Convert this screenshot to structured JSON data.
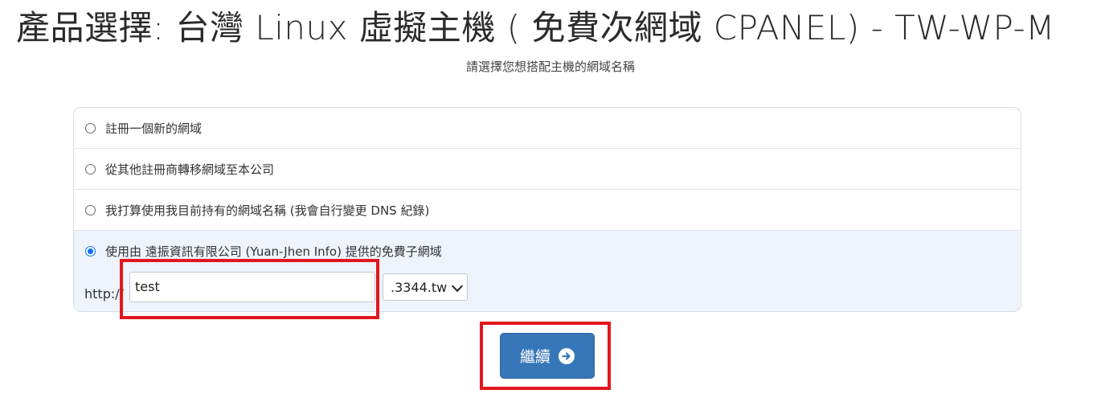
{
  "page": {
    "title": "產品選擇: 台灣 Linux 虛擬主機 ( 免費次網域 CPANEL) - TW-WP-M",
    "subtitle": "請選擇您想搭配主機的網域名稱"
  },
  "domain_options": [
    {
      "label": "註冊一個新的網域",
      "selected": false
    },
    {
      "label": "從其他註冊商轉移網域至本公司",
      "selected": false
    },
    {
      "label": "我打算使用我目前持有的網域名稱 (我會自行變更 DNS 紀錄)",
      "selected": false
    },
    {
      "label": "使用由 遠振資訊有限公司 (Yuan-Jhen Info) 提供的免費子網域",
      "selected": true
    }
  ],
  "subdomain": {
    "prefix": "http://",
    "value": "test",
    "tld_selected": ".3344.tw"
  },
  "continue_button": {
    "label": "繼續"
  },
  "colors": {
    "accent": "#3776b8",
    "highlight": "#e3161d",
    "selected_bg": "#eef3fc"
  }
}
